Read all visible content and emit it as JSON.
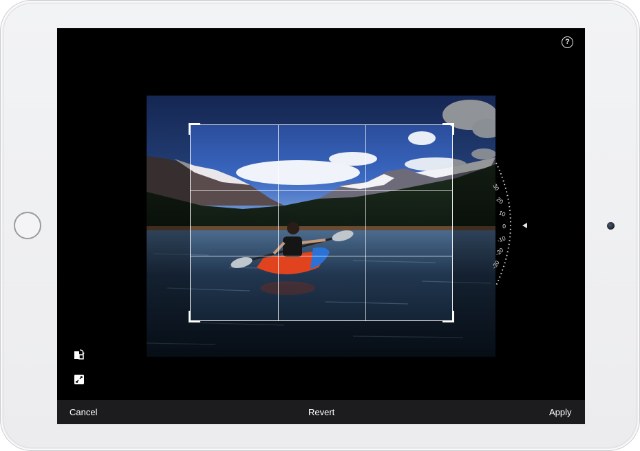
{
  "toolbar": {
    "cancel_label": "Cancel",
    "revert_label": "Revert",
    "apply_label": "Apply"
  },
  "help": {
    "label": "?"
  },
  "straighten_dial": {
    "labels": [
      "30",
      "20",
      "10",
      "0",
      "-10",
      "-20",
      "-30"
    ],
    "current_value": "0"
  },
  "colors": {
    "screen_background": "#000000",
    "toolbar_background": "#1c1c1e",
    "toolbar_text": "#ffffff",
    "device_frame": "#f2f3f5"
  },
  "icons": {
    "rotate": "rotate-icon",
    "aspect": "aspect-ratio-icon",
    "help": "help-icon"
  }
}
